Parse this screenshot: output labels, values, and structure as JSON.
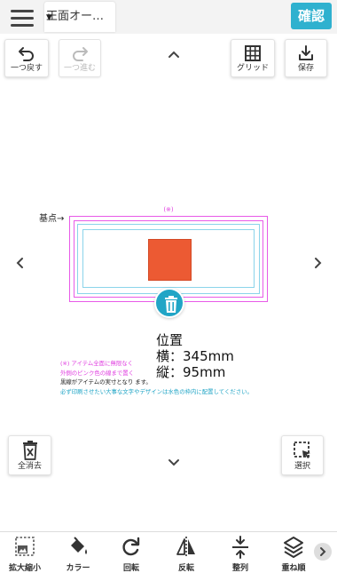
{
  "header": {
    "menu_icon": "hamburger-menu-icon",
    "view_tab_label": "正面オー…",
    "confirm_label": "確認"
  },
  "toolbar": {
    "undo_label": "一つ戻す",
    "redo_label": "一つ進む",
    "grid_label": "グリッド",
    "save_label": "保存"
  },
  "canvas": {
    "base_point_label": "基点→",
    "note_mark": "(※)",
    "item_color": "#ec5a33"
  },
  "position": {
    "title": "位置",
    "width": "横：345mm",
    "height": "縦：95mm"
  },
  "notes": {
    "line1": "(※) アイテム全面に無限なく",
    "line2": "外側のピンク色の線まで置く",
    "line3": "黒線がアイテムの実寸となり                                          ます。",
    "line4": "必ず印刷させたい大事な文字やデザインは水色の枠内に配置してください。"
  },
  "bottom_actions": {
    "clear_all_label": "全消去",
    "select_label": "選択"
  },
  "bottom_bar": {
    "items": [
      {
        "label": "拡大縮小",
        "icon": "resize-icon"
      },
      {
        "label": "カラー",
        "icon": "paint-bucket-icon"
      },
      {
        "label": "回転",
        "icon": "rotate-icon"
      },
      {
        "label": "反転",
        "icon": "flip-icon"
      },
      {
        "label": "整列",
        "icon": "align-icon"
      },
      {
        "label": "重ね順",
        "icon": "layers-icon"
      }
    ]
  },
  "colors": {
    "accent": "#2fb1cf",
    "pink_guide": "#e85ae8",
    "cyan_guide": "#8ad4ea"
  }
}
